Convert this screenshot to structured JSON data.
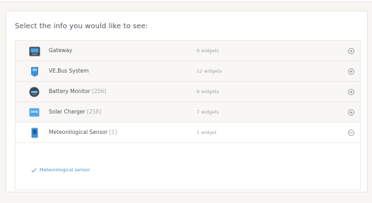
{
  "title": "Select the info you would like to see:",
  "devices": [
    {
      "name": "Gateway",
      "instance": "",
      "widgets": "9 widgets",
      "icon": "gateway-icon",
      "expanded": false
    },
    {
      "name": "VE.Bus System",
      "instance": "",
      "widgets": "12 widgets",
      "icon": "inverter-charger-icon",
      "expanded": false
    },
    {
      "name": "Battery Monitor",
      "instance": "[256]",
      "widgets": "8 widgets",
      "icon": "battery-monitor-icon",
      "expanded": false
    },
    {
      "name": "Solar Charger",
      "instance": "[258]",
      "widgets": "7 widgets",
      "icon": "solar-charger-icon",
      "expanded": false
    },
    {
      "name": "Meteorological Sensor",
      "instance": "[1]",
      "widgets": "1 widget",
      "icon": "meteorological-sensor-icon",
      "expanded": true
    }
  ],
  "expanded_widgets": [
    {
      "label": "Meteorological sensor",
      "checked": true
    }
  ],
  "colors": {
    "accent": "#4a90c9",
    "device_blue": "#3f8fd6",
    "device_dark": "#3e4a57"
  }
}
